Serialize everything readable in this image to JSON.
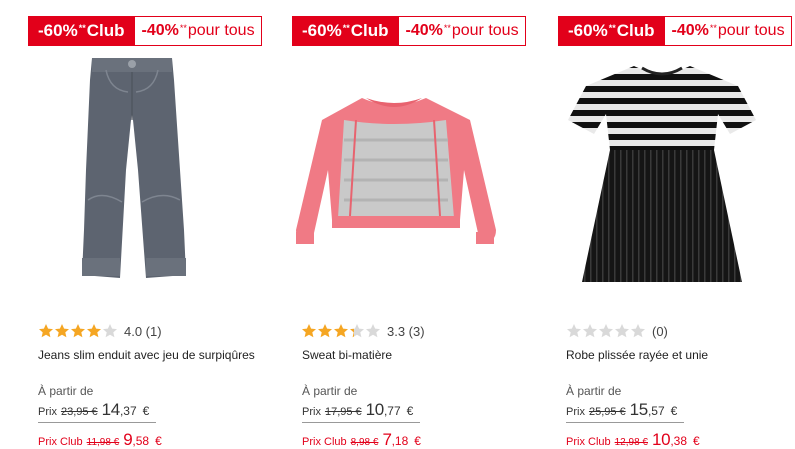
{
  "colors": {
    "accent": "#e2001a",
    "star_filled": "#f5a623",
    "star_empty": "#d9d9d9"
  },
  "products": [
    {
      "badge_club_pct": "-60%",
      "badge_stars": "**",
      "badge_club_label": "Club",
      "badge_all_pct": "-40%",
      "badge_all_label": "pour tous",
      "image": "grey-coated-slim-jeans",
      "rating_value": 4.0,
      "rating_text": "4.0 (1)",
      "name": "Jeans slim enduit avec jeu de surpiqûres",
      "from_label": "À partir de",
      "price_label": "Prix",
      "old_price": "23,95 €",
      "price_int": "14",
      "price_cents": ",37",
      "currency": "€",
      "club_label": "Prix Club",
      "club_old_price": "11,98 €",
      "club_int": "9",
      "club_cents": ",58",
      "club_currency": "€"
    },
    {
      "badge_club_pct": "-60%",
      "badge_stars": "**",
      "badge_club_label": "Club",
      "badge_all_pct": "-40%",
      "badge_all_label": "pour tous",
      "image": "pink-grey-sweatshirt",
      "rating_value": 3.3,
      "rating_text": "3.3 (3)",
      "name": "Sweat bi-matière",
      "from_label": "À partir de",
      "price_label": "Prix",
      "old_price": "17,95 €",
      "price_int": "10",
      "price_cents": ",77",
      "currency": "€",
      "club_label": "Prix Club",
      "club_old_price": "8,98 €",
      "club_int": "7",
      "club_cents": ",18",
      "club_currency": "€"
    },
    {
      "badge_club_pct": "-60%",
      "badge_stars": "**",
      "badge_club_label": "Club",
      "badge_all_pct": "-40%",
      "badge_all_label": "pour tous",
      "image": "striped-pleated-dress",
      "rating_value": 0,
      "rating_text": "(0)",
      "name": "Robe plissée rayée et unie",
      "from_label": "À partir de",
      "price_label": "Prix",
      "old_price": "25,95 €",
      "price_int": "15",
      "price_cents": ",57",
      "currency": "€",
      "club_label": "Prix Club",
      "club_old_price": "12,98 €",
      "club_int": "10",
      "club_cents": ",38",
      "club_currency": "€"
    }
  ]
}
